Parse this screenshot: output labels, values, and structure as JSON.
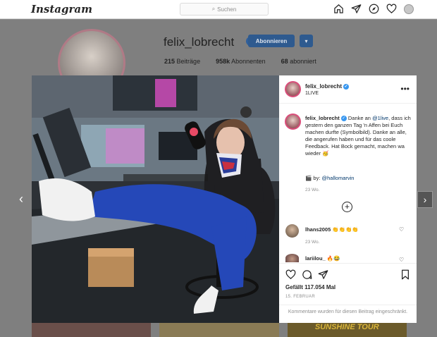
{
  "nav": {
    "logo": "Instagram",
    "search_placeholder": "Suchen",
    "icons": [
      "home-icon",
      "direct-icon",
      "explore-icon",
      "heart-icon",
      "profile-avatar"
    ]
  },
  "profile": {
    "username": "felix_lobrecht",
    "follow_label": "Abonnieren",
    "stats": {
      "posts_count": "215",
      "posts_label": "Beiträge",
      "followers_count": "958k",
      "followers_label": "Abonnenten",
      "following_count": "68",
      "following_label": "abonniert"
    },
    "thumb3_text": "SUNSHINE TOUR"
  },
  "post": {
    "header": {
      "username": "felix_lobrecht",
      "location": "1LIVE",
      "more": "•••"
    },
    "caption": {
      "username": "felix_lobrecht",
      "text_before": "Danke an ",
      "mention": "@1live",
      "text_after": ", dass ich gestern den ganzen Tag 'n Affen bei Euch machen durfte (Symbolbild). Danke an alle, die angerufen haben und für das coole Feedback. Hat Bock gemacht, machen wa wieder 🥳",
      "byline_prefix": "🎬 by: ",
      "byline_mention": "@hallomarvin",
      "time": "23 Wo."
    },
    "comments": [
      {
        "username": "lhans2005",
        "text": "👏👏👏👏",
        "time": "23 Wo."
      },
      {
        "username": "lariilou_",
        "text": "🔥😂"
      }
    ],
    "likes_text": "Gefällt 117.054 Mal",
    "date": "15. FEBRUAR",
    "comments_disabled": "Kommentare wurden für diesen Beitrag eingeschränkt.",
    "colors": {
      "accent_blue": "#3897f0",
      "jersey_blue": "#2548b8",
      "link": "#00376b"
    }
  }
}
